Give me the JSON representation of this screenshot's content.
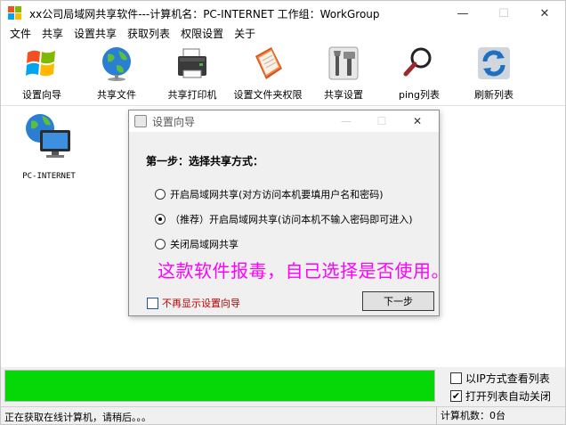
{
  "window": {
    "title": "xx公司局域网共享软件---计算机名：PC-INTERNET  工作组：WorkGroup",
    "minimize": "—",
    "maximize": "☐",
    "close": "✕"
  },
  "menu": [
    "文件",
    "共享",
    "设置共享",
    "获取列表",
    "权限设置",
    "关于"
  ],
  "toolbar": [
    {
      "label": "设置向导",
      "icon": "windows-flag-icon"
    },
    {
      "label": "共享文件",
      "icon": "globe-icon"
    },
    {
      "label": "共享打印机",
      "icon": "printer-icon"
    },
    {
      "label": "设置文件夹权限",
      "icon": "folder-book-icon"
    },
    {
      "label": "共享设置",
      "icon": "tools-icon"
    },
    {
      "label": "ping列表",
      "icon": "magnifier-icon"
    },
    {
      "label": "刷新列表",
      "icon": "refresh-icon"
    }
  ],
  "hosts": [
    {
      "name": "PC-INTERNET",
      "icon": "network-computer-icon"
    }
  ],
  "dialog": {
    "title": "设置向导",
    "close": "✕",
    "step": "第一步：选择共享方式：",
    "options": [
      {
        "label": "开启局域网共享(对方访问本机要填用户名和密码)",
        "selected": false
      },
      {
        "label": "（推荐）开启局域网共享(访问本机不输入密码即可进入)",
        "selected": true
      },
      {
        "label": "关闭局域网共享",
        "selected": false
      }
    ],
    "warning": "这款软件报毒，自己选择是否使用。",
    "no_show_label": "不再显示设置向导",
    "no_show_checked": false,
    "next_label": "下一步"
  },
  "bottom": {
    "progress": 1.0,
    "progress_color": "#06d706",
    "ip_view_label": "以IP方式查看列表",
    "ip_view_checked": false,
    "auto_close_label": "打开列表自动关闭",
    "auto_close_checked": true
  },
  "status": {
    "left": "正在获取在线计算机，请稍后。。。",
    "right": "计算机数：0台"
  }
}
